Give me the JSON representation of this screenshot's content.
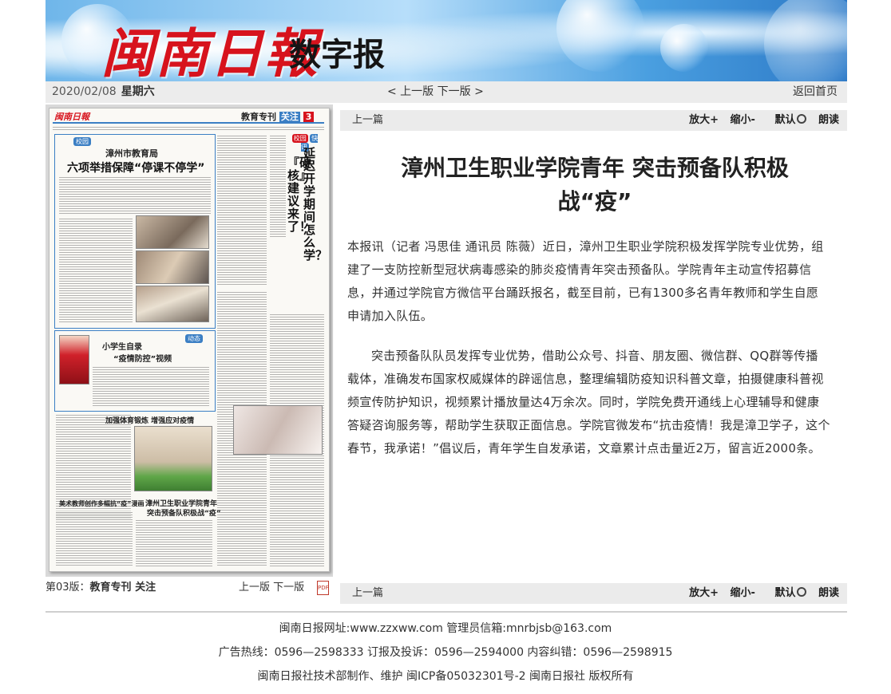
{
  "banner": {
    "logo_main": "闽南日報",
    "logo_sub": "数字报"
  },
  "datebar": {
    "date": "2020/02/08",
    "weekday": "星期六",
    "page_nav": "< 上一版 下一版 >",
    "home": "返回首页"
  },
  "paper": {
    "masthead": "闽南日報",
    "section": "教育专刊",
    "focus": "关注",
    "page_no": "3",
    "headline_org": "漳州市教育局",
    "headline_main": "六项举措保障“停课不停学”",
    "side_title": "延迟开学期间怎么学？",
    "side_title2": "『硬核』建议来了！",
    "side_tag": "校园",
    "side_tag2": "快讯",
    "tag_left": "校园",
    "tag_mid": "动态",
    "story2_title": "小学生自录",
    "story2_sub": "“疫情防控”视频",
    "story3_title": "加强体育锻炼 增强应对疫情",
    "story4_title": "漳州卫生职业学院青年",
    "story4_sub": "突击预备队积极战“疫”",
    "story5_title": "美术教师创作多幅抗“疫”漫画"
  },
  "page_caption": {
    "page": "第03版：",
    "page_name": "教育专刊 关注",
    "nav": "上一版 下一版",
    "pdf": "PDF"
  },
  "toolbar": {
    "prev": "上一篇",
    "zoom_in": "放大+",
    "zoom_out": "缩小-",
    "default": "默认",
    "read": "朗读"
  },
  "article": {
    "title_line1": "漳州卫生职业学院青年 突击预备队积极",
    "title_line2": "战“疫”",
    "para1": "本报讯（记者 冯思佳 通讯员 陈薇）近日，漳州卫生职业学院积极发挥学院专业优势，组建了一支防控新型冠状病毒感染的肺炎疫情青年突击预备队。学院青年主动宣传招募信息，并通过学院官方微信平台踊跃报名，截至目前，已有1300多名青年教师和学生自愿申请加入队伍。",
    "para2": "突击预备队队员发挥专业优势，借助公众号、抖音、朋友圈、微信群、QQ群等传播载体，准确发布国家权威媒体的辟谣信息，整理编辑防疫知识科普文章，拍摄健康科普视频宣传防护知识，视频累计播放量达4万余次。同时，学院免费开通线上心理辅导和健康答疑咨询服务等，帮助学生获取正面信息。学院官微发布“抗击疫情！我是漳卫学子，这个春节，我承诺！”倡议后，青年学生自发承诺，文章累计点击量近2万，留言近2000条。"
  },
  "footer": {
    "line1": "闽南日报网址:www.zzxww.com 管理员信箱:mnrbjsb@163.com",
    "line2": "广告热线：0596—2598333 订报及投诉：0596—2594000 内容纠错：0596—2598915",
    "line3": "闽南日报社技术部制作、维护 闽ICP备05032301号-2 闽南日报社 版权所有"
  },
  "colors": {
    "logo_red": "#d7131d",
    "toolbar_bg": "#ebebeb",
    "paper_page_red": "#d7131d"
  }
}
